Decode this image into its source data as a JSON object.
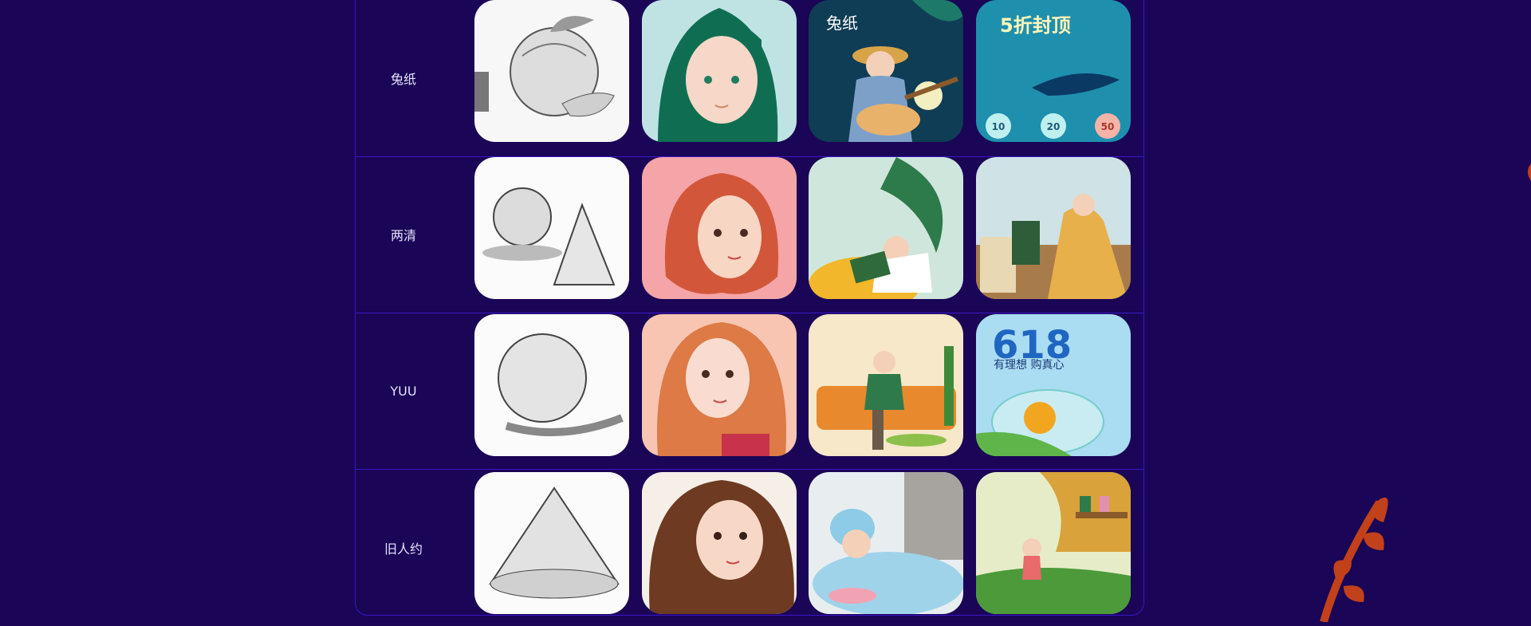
{
  "rows": [
    {
      "name": "兔纸",
      "tiles": [
        "pencil-fruit-sketch",
        "green-hair-girl-portrait",
        "girl-guitar-night-scene",
        "undersea-promo-poster"
      ]
    },
    {
      "name": "两清",
      "tiles": [
        "sphere-cone-sketch",
        "red-hair-girl-portrait",
        "girl-reading-plants",
        "girl-golden-dress-window"
      ]
    },
    {
      "name": "YUU",
      "tiles": [
        "sphere-sketch",
        "orange-hair-girl-portrait",
        "girl-sofa-livingroom",
        "618-promo-fishbowl"
      ]
    },
    {
      "name": "旧人约",
      "tiles": [
        "cone-sketch",
        "brown-hair-girl-portrait",
        "girl-bath-bunny-ears",
        "girl-cliff-shop-scene"
      ]
    }
  ],
  "tile_texts": {
    "poster_title": "5折封顶",
    "coupon1": "10",
    "coupon2": "20",
    "coupon3": "50",
    "promo_number": "618",
    "promo_slogan": "有理想 购真心",
    "scene_text": "兔纸"
  },
  "colors": {
    "background": "#1a0556",
    "border": "#3b16c9",
    "label": "#e8e2ff",
    "accent_sprig": "#c2411a"
  }
}
